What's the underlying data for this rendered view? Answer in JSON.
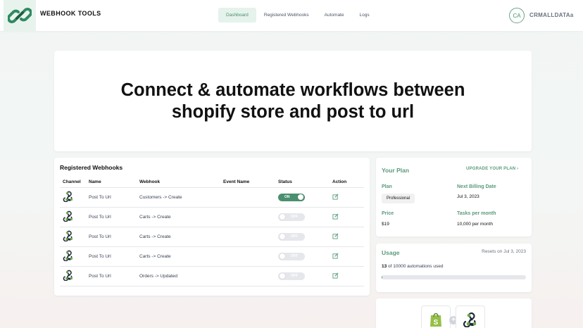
{
  "app": {
    "brand": "WEBHOOK TOOLS",
    "user_initials": "CA",
    "user_name": "CRMALLDATAa",
    "accent": "#4a8f6f"
  },
  "nav": [
    {
      "label": "Dashboard",
      "active": true
    },
    {
      "label": "Registered Webhooks",
      "active": false
    },
    {
      "label": "Automate",
      "active": false
    },
    {
      "label": "Logs",
      "active": false
    }
  ],
  "hero": {
    "title": "Connect & automate workflows between shopify store and post to url"
  },
  "webhooks": {
    "title": "Registered Webhooks",
    "columns": [
      "Channel",
      "Name",
      "Webhook",
      "Event Name",
      "Status",
      "Action"
    ],
    "rows": [
      {
        "name": "Post To Url",
        "webhook": "Customers -> Create",
        "event": "",
        "status": "ON"
      },
      {
        "name": "Post To Url",
        "webhook": "Carts -> Create",
        "event": "",
        "status": "OFF"
      },
      {
        "name": "Post To Url",
        "webhook": "Carts -> Create",
        "event": "",
        "status": "OFF"
      },
      {
        "name": "Post To Url",
        "webhook": "Carts -> Create",
        "event": "",
        "status": "OFF"
      },
      {
        "name": "Post To Url",
        "webhook": "Orders -> Updated",
        "event": "",
        "status": "OFF"
      }
    ]
  },
  "plan": {
    "title": "Your Plan",
    "upgrade": "UPGRADE YOUR PLAN",
    "plan_label": "Plan",
    "plan_value": "Professional",
    "billing_label": "Next Billing Date",
    "billing_value": "Jul 3, 2023",
    "price_label": "Price",
    "price_value": "$19",
    "tasks_label": "Tasks per month",
    "tasks_value": "10,000 per month"
  },
  "usage": {
    "title": "Usage",
    "reset": "Resets on Jul 3, 2023",
    "used": "13",
    "used_suffix": " of 10000 automations used",
    "progress_fraction": 0.0013
  }
}
